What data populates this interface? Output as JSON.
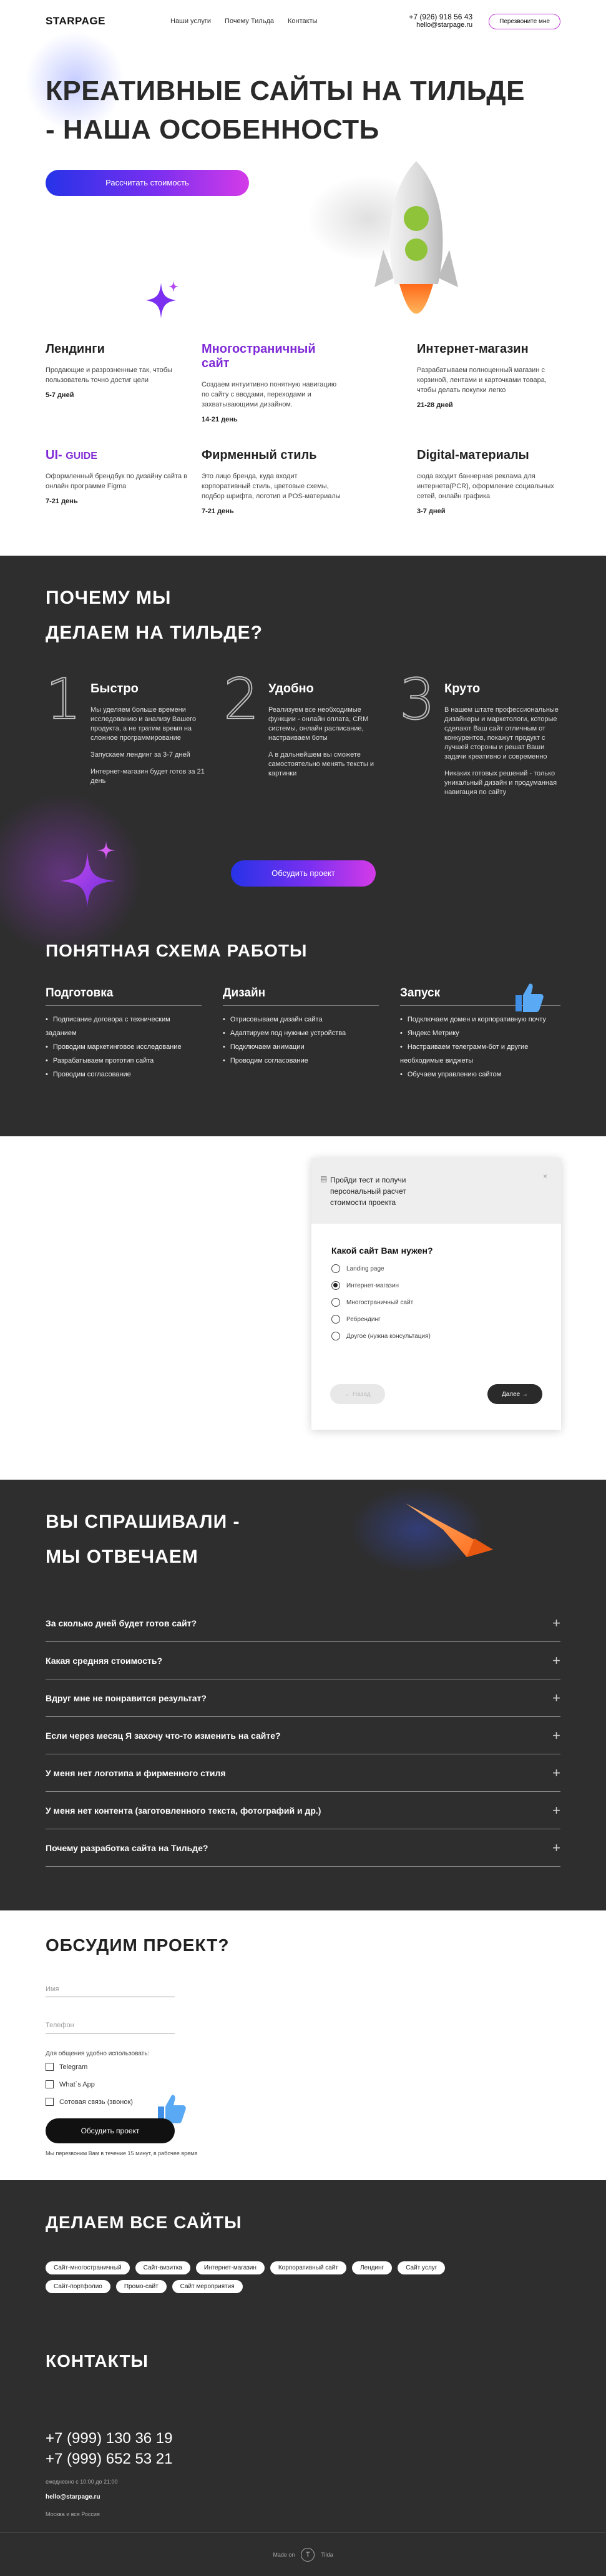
{
  "header": {
    "logo": "STARPAGE",
    "nav": [
      "Наши услуги",
      "Почему Тильда",
      "Контакты"
    ],
    "phone": "+7 (926) 918 56 43",
    "email": "hello@starpage.ru",
    "callback_label": "Перезвоните мне"
  },
  "hero": {
    "title_line1": "КРЕАТИВНЫЕ САЙТЫ НА ТИЛЬДЕ",
    "title_line2": "- НАША ОСОБЕННОСТЬ",
    "cta": "Рассчитать стоимость"
  },
  "services": [
    {
      "title": "Лендинги",
      "desc": "Продающие и разрозненные так, чтобы пользователь точно достиг цели",
      "days": "5-7 дней"
    },
    {
      "title": "Многостраничный сайт",
      "desc": "Создаем интуитивно понятную навигацию по сайту с вводами, переходами и захватывающими дизайном.",
      "days": "14-21 день"
    },
    {
      "title": "Интернет-магазин",
      "desc": "Разрабатываем полноценный магазин с корзиной, лентами и карточками товара, чтобы делать покупки легко",
      "days": "21-28 дней"
    },
    {
      "title_prefix": "UI-",
      "title_suffix": "GUIDE",
      "desc": "Оформленный брендбук по дизайну сайта в онлайн программе Figma",
      "days": "7-21 день"
    },
    {
      "title": "Фирменный стиль",
      "desc": "Это лицо бренда, куда входит корпоративный стиль, цветовые схемы, подбор шрифта, логотип и POS-материалы",
      "days": "7-21 день"
    },
    {
      "title": "Digital-материалы",
      "desc": "сюда входит баннерная реклама для интернета(PCR), оформление социальных сетей, онлайн графика",
      "days": "3-7 дней"
    }
  ],
  "why": {
    "title_line1": "ПОЧЕМУ МЫ",
    "title_line2": "ДЕЛАЕМ НА ТИЛЬДЕ?",
    "items": [
      {
        "num": "1",
        "title": "Быстро",
        "p1": "Мы уделяем больше времени исследованию и анализу Вашего продукта, а не тратим время на сложное программирование",
        "p2": "Запускаем лендинг за 3-7 дней",
        "p3": "Интернет-магазин будет готов за 21 день"
      },
      {
        "num": "2",
        "title": "Удобно",
        "p1": "Реализуем все необходимые функции - онлайн оплата, CRM системы, онлайн расписание, настраиваем боты",
        "p2": "А в дальнейшем вы сможете самостоятельно менять тексты и картинки"
      },
      {
        "num": "3",
        "title": "Круто",
        "p1": "В нашем штате профессиональные дизайнеры и маркетологи, которые сделают Ваш сайт отличным от конкурентов, покажут продукт с лучшей стороны и решат Ваши задачи креативно и современно",
        "p2": "Никаких готовых решений - только уникальный дизайн и продуманная навигация по сайту"
      }
    ],
    "cta": "Обсудить проект"
  },
  "scheme": {
    "title": "ПОНЯТНАЯ СХЕМА РАБОТЫ",
    "columns": [
      {
        "title": "Подготовка",
        "items": [
          "Подписание договора с техническим заданием",
          "Проводим маркетинговое исследование",
          "Разрабатываем прототип сайта",
          "Проводим согласование"
        ]
      },
      {
        "title": "Дизайн",
        "items": [
          "Отрисовываем дизайн сайта",
          "Адаптируем под нужные устройства",
          "Подключаем анимации",
          "Проводим согласование"
        ]
      },
      {
        "title": "Запуск",
        "items": [
          "Подключаем домен и корпоративную почту",
          "Яндекс Метрику",
          "Настраиваем телеграмм-бот и другие необходимые виджеты",
          "Обучаем управлению сайтом"
        ]
      }
    ]
  },
  "quiz": {
    "header": "Пройди тест и получи персональный расчет стоимости проекта",
    "close": "×",
    "question": "Какой сайт Вам нужен?",
    "options": [
      "Landing page",
      "Интернет-магазин",
      "Многостраничный сайт",
      "Ребрендинг",
      "Другое (нужна консультация)"
    ],
    "selected": 1,
    "back": "← Назад",
    "next": "Далее →"
  },
  "faq": {
    "title_line1": "ВЫ СПРАШИВАЛИ -",
    "title_line2": "МЫ ОТВЕЧАЕМ",
    "items": [
      "За сколько дней будет готов сайт?",
      "Какая средняя стоимость?",
      "Вдруг мне не понравится результат?",
      "Если через месяц Я захочу что-то изменить на сайте?",
      "У меня нет логотипа и фирменного стиля",
      "У меня нет контента (заготовленного текста, фотографий и др.)",
      "Почему разработка сайта на Тильде?"
    ],
    "plus": "+"
  },
  "discuss": {
    "title": "ОБСУДИМ ПРОЕКТ?",
    "name_placeholder": "Имя",
    "phone_placeholder": "Телефон",
    "method_label": "Для общения удобно использовать:",
    "methods": [
      "Telegram",
      "What`s App",
      "Сотовая связь (звонок)"
    ],
    "submit": "Обсудить проект",
    "note": "Мы перезвоним Вам в течение 15 минут, в рабочее время"
  },
  "sites": {
    "title": "ДЕЛАЕМ ВСЕ САЙТЫ",
    "tags": [
      "Сайт-многостраничный",
      "Сайт-визитка",
      "Интернет-магазин",
      "Корпоративный сайт",
      "Лендинг",
      "Сайт услуг",
      "Сайт-портфолио",
      "Промо-сайт",
      "Сайт мероприятия"
    ]
  },
  "contacts": {
    "title": "КОНТАКТЫ",
    "phone1": "+7 (999) 130 36 19",
    "phone2": "+7 (999) 652 53 21",
    "hours": "ежедневно с 10:00 до 21:00",
    "email": "hello@starpage.ru",
    "city": "Москва и вся Россия"
  },
  "footer": {
    "made_on": "Made on",
    "tilda_letter": "T",
    "tilda": "Tilda"
  },
  "colors": {
    "accent_purple": "#7f2ad6",
    "gradient_start": "#2633e8",
    "gradient_end": "#d43be8",
    "dark_bg": "#2e2e2e"
  }
}
